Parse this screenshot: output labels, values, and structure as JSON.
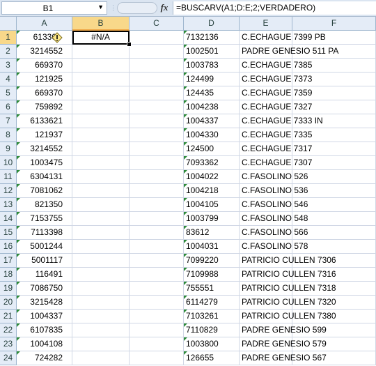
{
  "name_box": "B1",
  "formula_bar": {
    "fx_label": "fx",
    "formula": "=BUSCARV(A1;D:E;2;VERDADERO)"
  },
  "columns": [
    "A",
    "B",
    "C",
    "D",
    "E",
    "F"
  ],
  "active_cell": {
    "ref": "B1",
    "value": "#N/A"
  },
  "rows": [
    {
      "num": "1",
      "a": "61330",
      "d": "7132136",
      "e": "C.ECHAGUE 7399 PB"
    },
    {
      "num": "2",
      "a": "3214552",
      "d": "1002501",
      "e": "PADRE GENESIO 511 PA"
    },
    {
      "num": "3",
      "a": "669370",
      "d": "1003783",
      "e": "C.ECHAGUE 7385"
    },
    {
      "num": "4",
      "a": "121925",
      "d": "124499",
      "e": "C.ECHAGUE 7373"
    },
    {
      "num": "5",
      "a": "669370",
      "d": "124435",
      "e": "C.ECHAGUE 7359"
    },
    {
      "num": "6",
      "a": "759892",
      "d": "1004238",
      "e": "C.ECHAGUE 7327"
    },
    {
      "num": "7",
      "a": "6133621",
      "d": "1004337",
      "e": "C.ECHAGUE 7333  IN"
    },
    {
      "num": "8",
      "a": "121937",
      "d": "1004330",
      "e": "C.ECHAGUE 7335"
    },
    {
      "num": "9",
      "a": "3214552",
      "d": "124500",
      "e": "C.ECHAGUE 7317"
    },
    {
      "num": "10",
      "a": "1003475",
      "d": "7093362",
      "e": "C.ECHAGUE 7307"
    },
    {
      "num": "11",
      "a": "6304131",
      "d": "1004022",
      "e": "C.FASOLINO 526"
    },
    {
      "num": "12",
      "a": "7081062",
      "d": "1004218",
      "e": "C.FASOLINO 536"
    },
    {
      "num": "13",
      "a": "821350",
      "d": "1004105",
      "e": "C.FASOLINO 546"
    },
    {
      "num": "14",
      "a": "7153755",
      "d": "1003799",
      "e": "C.FASOLINO 548"
    },
    {
      "num": "15",
      "a": "7113398",
      "d": "83612",
      "e": "C.FASOLINO 566"
    },
    {
      "num": "16",
      "a": "5001244",
      "d": "1004031",
      "e": "C.FASOLINO 578"
    },
    {
      "num": "17",
      "a": "5001117",
      "d": "7099220",
      "e": "PATRICIO CULLEN 7306"
    },
    {
      "num": "18",
      "a": "116491",
      "d": "7109988",
      "e": "PATRICIO CULLEN 7316"
    },
    {
      "num": "19",
      "a": "7086750",
      "d": "755551",
      "e": "PATRICIO CULLEN 7318"
    },
    {
      "num": "20",
      "a": "3215428",
      "d": "6114279",
      "e": "PATRICIO CULLEN 7320"
    },
    {
      "num": "21",
      "a": "1004337",
      "d": "7103261",
      "e": "PATRICIO CULLEN 7380"
    },
    {
      "num": "22",
      "a": "6107835",
      "d": "7110829",
      "e": "PADRE GENESIO 599"
    },
    {
      "num": "23",
      "a": "1004108",
      "d": "1003800",
      "e": "PADRE GENESIO 579"
    },
    {
      "num": "24",
      "a": "724282",
      "d": "126655",
      "e": "PADRE GENESIO 567"
    }
  ]
}
